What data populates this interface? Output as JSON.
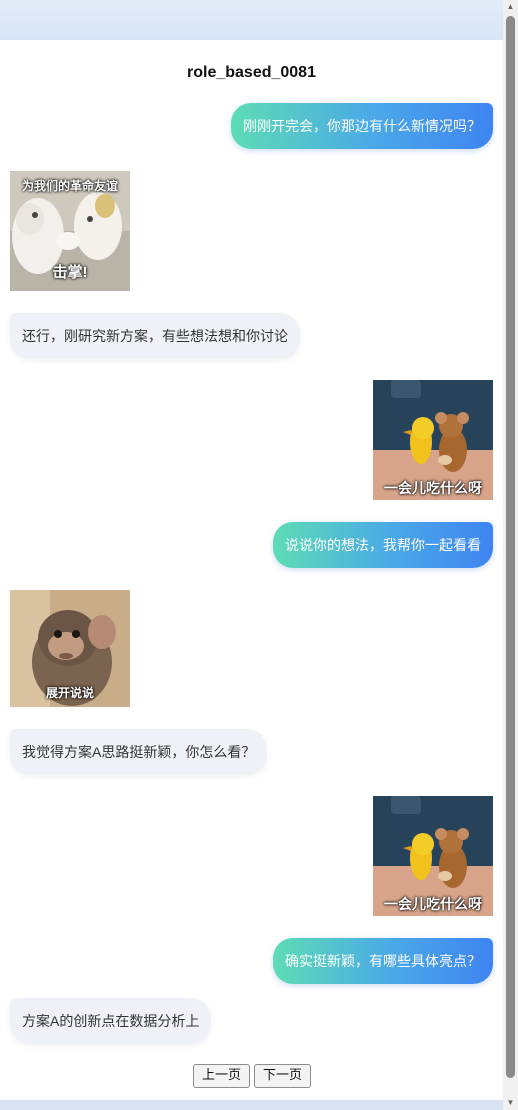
{
  "chat": {
    "title": "role_based_0081",
    "messages": [
      {
        "side": "me",
        "kind": "text",
        "text": "刚刚开完会，你那边有什么新情况吗？"
      },
      {
        "side": "other",
        "kind": "sticker",
        "sticker": "cat-high-five",
        "caption_top": "为我们的革命友谊",
        "caption_bottom": "击掌!"
      },
      {
        "side": "other",
        "kind": "text",
        "text": "还行，刚研究新方案，有些想法想和你讨论"
      },
      {
        "side": "me",
        "kind": "sticker",
        "sticker": "jerry-mouse-duckling",
        "caption_bottom": "一会儿吃什么呀"
      },
      {
        "side": "me",
        "kind": "text",
        "text": "说说你的想法，我帮你一起看看"
      },
      {
        "side": "other",
        "kind": "sticker",
        "sticker": "baby-monkey",
        "caption_bottom": "展开说说"
      },
      {
        "side": "other",
        "kind": "text",
        "text": "我觉得方案A思路挺新颖，你怎么看？"
      },
      {
        "side": "me",
        "kind": "sticker",
        "sticker": "jerry-mouse-duckling",
        "caption_bottom": "一会儿吃什么呀"
      },
      {
        "side": "me",
        "kind": "text",
        "text": "确实挺新颖，有哪些具体亮点？"
      },
      {
        "side": "other",
        "kind": "text",
        "text": "方案A的创新点在数据分析上"
      }
    ]
  },
  "pager": {
    "prev_label": "上一页",
    "next_label": "下一页"
  },
  "colors": {
    "me_bubble_start": "#5edcb4",
    "me_bubble_end": "#3f84f2",
    "other_bubble": "#eef2f8"
  },
  "icons": [
    "scroll-up-arrow-icon",
    "scroll-down-arrow-icon"
  ]
}
